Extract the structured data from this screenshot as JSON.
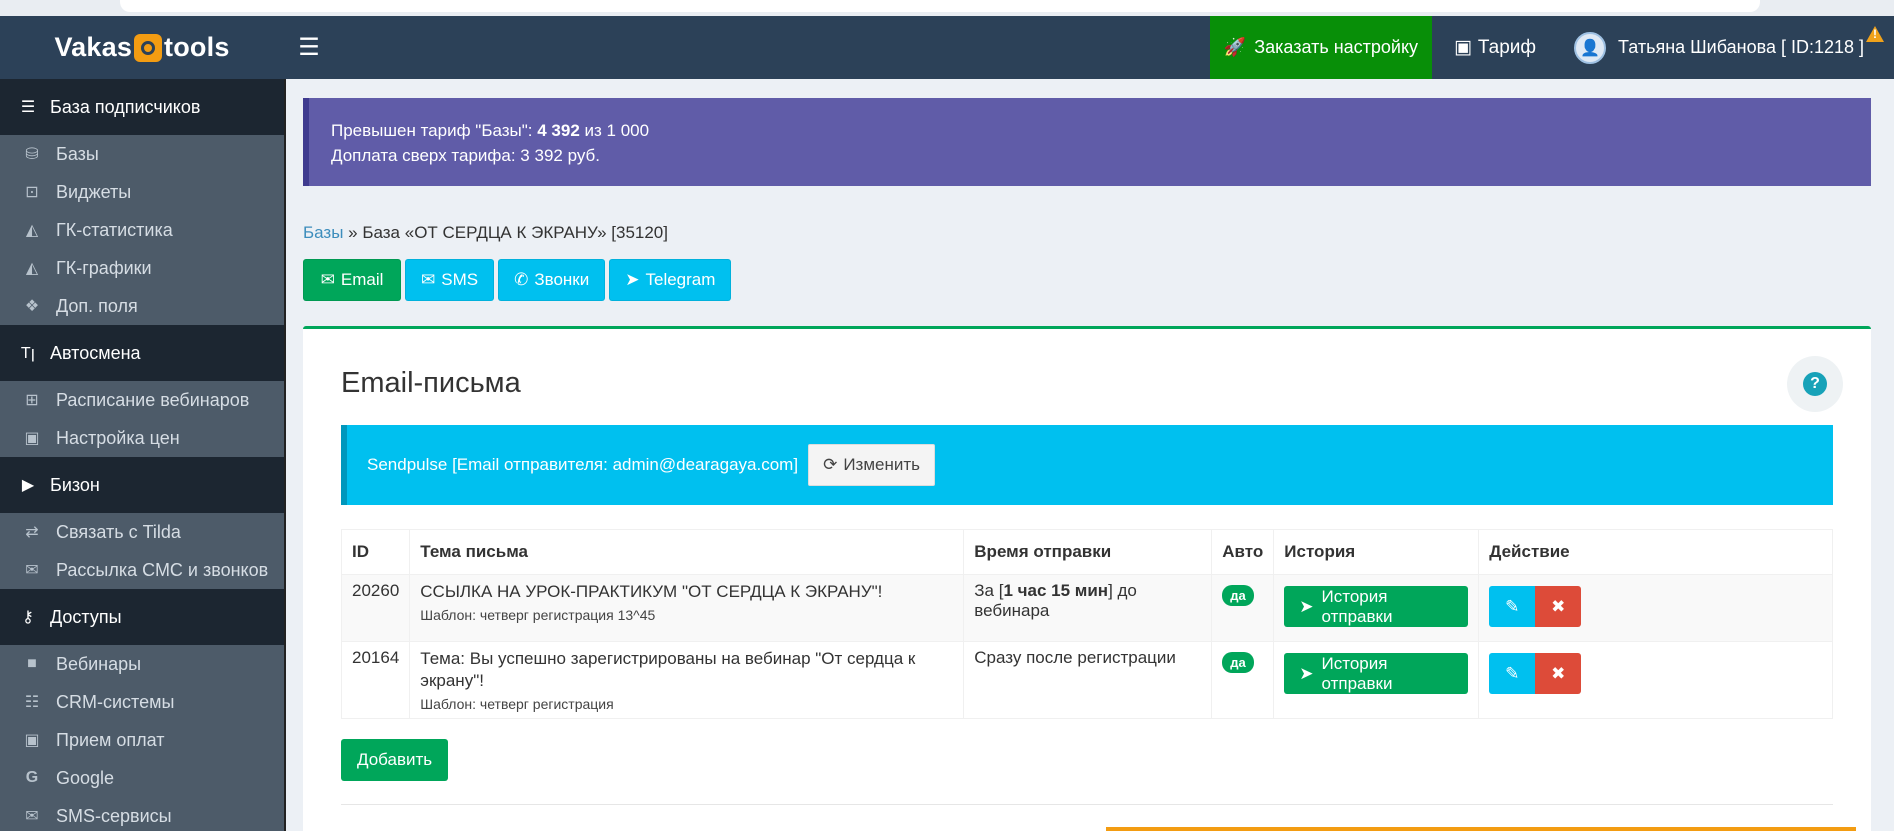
{
  "header": {
    "logo_left": "Vakas",
    "logo_right": "tools",
    "order_label": "Заказать настройку",
    "tariff_label": "Тариф",
    "user_name": "Татьяна Шибанова [ ID:1218 ]"
  },
  "sidebar": {
    "sections": [
      {
        "label": "База подписчиков",
        "icon": "database-list-icon",
        "items": [
          {
            "label": "Базы",
            "icon": "database-icon"
          },
          {
            "label": "Виджеты",
            "icon": "widget-icon"
          },
          {
            "label": "ГК-статистика",
            "icon": "area-chart-icon"
          },
          {
            "label": "ГК-графики",
            "icon": "area-chart-icon"
          },
          {
            "label": "Доп. поля",
            "icon": "cubes-icon"
          }
        ]
      },
      {
        "label": "Автосмена",
        "icon": "text-cursor-icon",
        "items": [
          {
            "label": "Расписание вебинаров",
            "icon": "calendar-plus-icon"
          },
          {
            "label": "Настройка цен",
            "icon": "money-icon"
          }
        ]
      },
      {
        "label": "Бизон",
        "icon": "youtube-icon",
        "items": [
          {
            "label": "Связать с Tilda",
            "icon": "exchange-icon"
          },
          {
            "label": "Рассылка СМС и звонков",
            "icon": "envelope-icon"
          }
        ]
      },
      {
        "label": "Доступы",
        "icon": "key-icon",
        "items": [
          {
            "label": "Вебинары",
            "icon": "video-icon"
          },
          {
            "label": "CRM-системы",
            "icon": "server-icon"
          },
          {
            "label": "Прием оплат",
            "icon": "money-icon"
          },
          {
            "label": "Google",
            "icon": "google-icon"
          },
          {
            "label": "SMS-сервисы",
            "icon": "envelope-icon"
          }
        ]
      }
    ]
  },
  "alert": {
    "line1_prefix": "Превышен тариф \"Базы\": ",
    "line1_count": "4 392",
    "line1_suffix": " из 1 000",
    "line2": "Доплата сверх тарифа: 3 392 руб."
  },
  "breadcrumb": {
    "link": "Базы",
    "separator": " » ",
    "current": "База «ОТ СЕРДЦА К ЭКРАНУ» [35120]"
  },
  "channels": {
    "email": "Email",
    "sms": "SMS",
    "calls": "Звонки",
    "telegram": "Telegram"
  },
  "box": {
    "title": "Email-письма",
    "sender_text": "Sendpulse [Email отправителя: admin@dearagaya.com]",
    "change_label": "Изменить",
    "add_label": "Добавить"
  },
  "table": {
    "headers": [
      "ID",
      "Тема письма",
      "Время отправки",
      "Авто",
      "История",
      "Действие"
    ],
    "rows": [
      {
        "id": "20260",
        "subject": "ССЫЛКА НА УРОК-ПРАКТИКУМ \"ОТ СЕРДЦА К ЭКРАНУ\"!",
        "template": "Шаблон: четверг регистрация 13^45",
        "time_prefix": "За [",
        "time_bold": "1 час 15 мин",
        "time_suffix": "] до вебинара",
        "auto": "да",
        "history": "История отправки"
      },
      {
        "id": "20164",
        "subject": "Тема: Вы успешно зарегистрированы на вебинар \"От сердца к экрану\"!",
        "template": "Шаблон: четверг регистрация",
        "time_prefix": "Сразу после регистрации",
        "time_bold": "",
        "time_suffix": "",
        "auto": "да",
        "history": "История отправки"
      }
    ]
  },
  "colors": {
    "header_bg": "#2c4158",
    "order_bg": "#088f08",
    "alert_purple": "#605ca8",
    "green": "#00a65a",
    "cyan": "#00c0ef",
    "red": "#dd4b39"
  }
}
